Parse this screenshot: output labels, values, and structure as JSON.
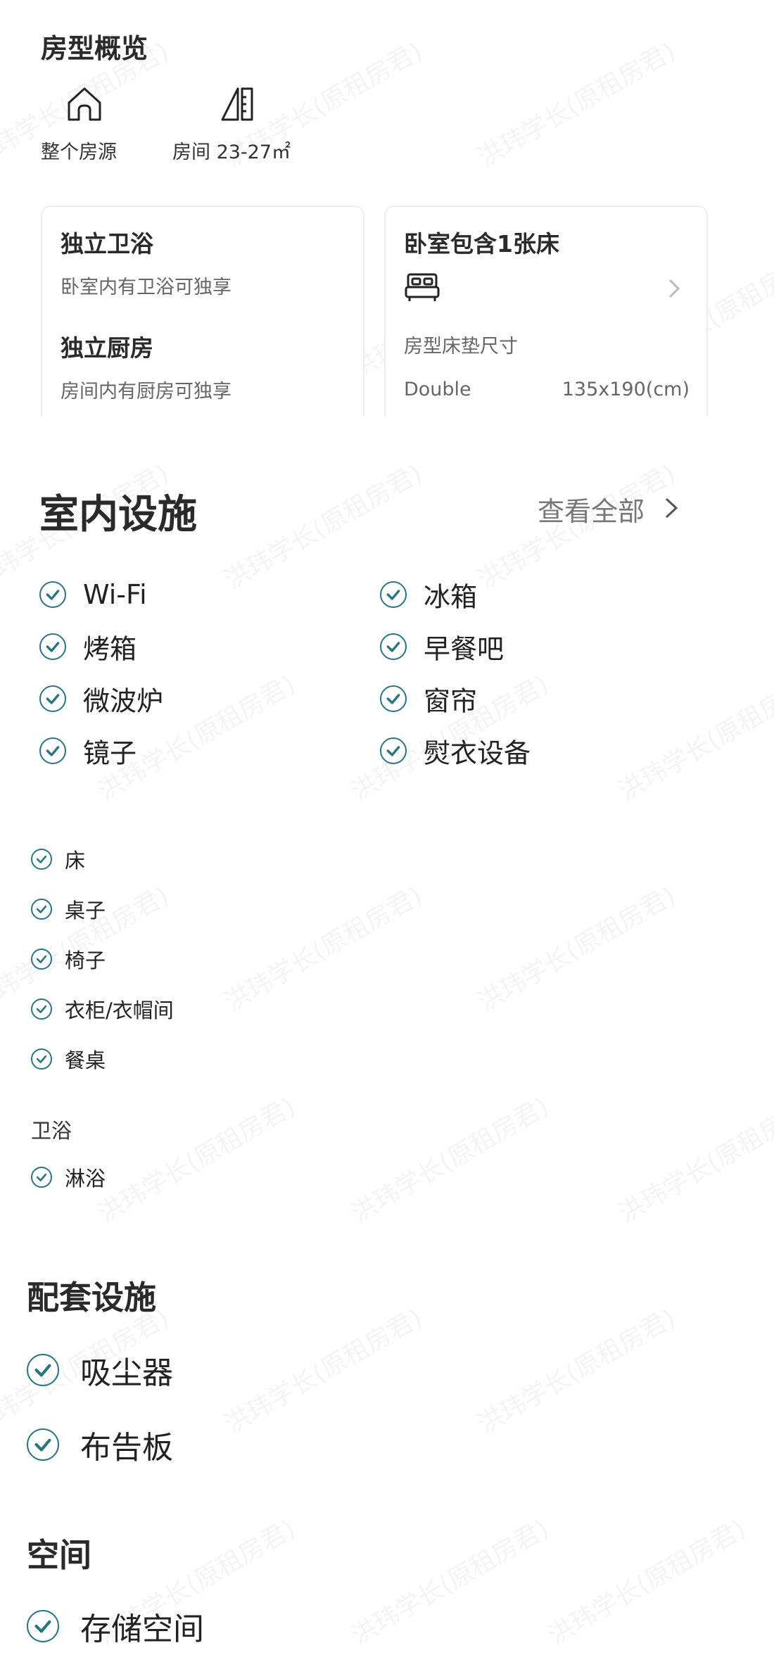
{
  "overview": {
    "title": "房型概览",
    "items": [
      {
        "icon": "house-icon",
        "label": "整个房源"
      },
      {
        "icon": "room-size-icon",
        "label": "房间 23-27㎡"
      }
    ]
  },
  "cards": {
    "left": {
      "rows": [
        {
          "title": "独立卫浴",
          "desc": "卧室内有卫浴可独享"
        },
        {
          "title": "独立厨房",
          "desc": "房间内有厨房可独享"
        }
      ]
    },
    "right": {
      "title": "卧室包含1张床",
      "bed_icon": "bed-icon",
      "mattress_label": "房型床垫尺寸",
      "bed_type": "Double",
      "bed_size": "135x190(cm)"
    }
  },
  "indoor": {
    "title": "室内设施",
    "view_all": "查看全部",
    "grid": [
      "Wi-Fi",
      "冰箱",
      "烤箱",
      "早餐吧",
      "微波炉",
      "窗帘",
      "镜子",
      "熨衣设备"
    ],
    "furniture": [
      "床",
      "桌子",
      "椅子",
      "衣柜/衣帽间",
      "餐桌"
    ],
    "bathroom_title": "卫浴",
    "bathroom": [
      "淋浴"
    ]
  },
  "supporting": {
    "title": "配套设施",
    "items": [
      "吸尘器",
      "布告板"
    ]
  },
  "space": {
    "title": "空间",
    "items": [
      "存储空间"
    ]
  },
  "watermark": "洪玮学长(原租房君)",
  "colors": {
    "accent": "#2a7583",
    "text": "#222222",
    "muted": "#666666"
  }
}
